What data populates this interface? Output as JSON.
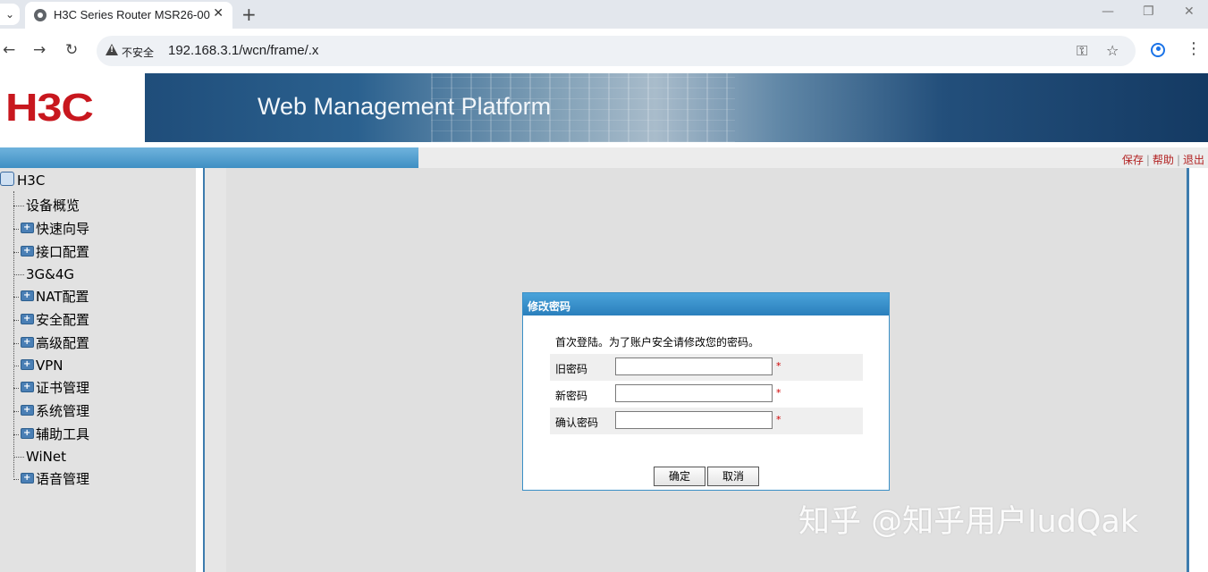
{
  "browser": {
    "tab_title": "H3C Series Router MSR26-00",
    "tab_menu_glyph": "⌄",
    "tab_close_glyph": "✕",
    "new_tab_glyph": "+",
    "window_controls": {
      "minimize": "—",
      "restore": "❐",
      "close": "✕"
    },
    "nav": {
      "back": "←",
      "forward": "→",
      "reload": "↻"
    },
    "security_label": "不安全",
    "url": "192.168.3.1/wcn/frame/.x",
    "icons": {
      "key": "⚿",
      "star": "☆",
      "menu": "⋮"
    }
  },
  "header": {
    "logo_text": "H3C",
    "title": "Web Management Platform",
    "links": {
      "save": "保存",
      "help": "帮助",
      "logout": "退出"
    },
    "accent_color": "#3d7cae",
    "brand_color": "#c8171e"
  },
  "sidebar": {
    "root": "H3C",
    "items": [
      {
        "label": "设备概览",
        "folder": false
      },
      {
        "label": "快速向导",
        "folder": true
      },
      {
        "label": "接口配置",
        "folder": true
      },
      {
        "label": "3G&4G",
        "folder": false
      },
      {
        "label": "NAT配置",
        "folder": true
      },
      {
        "label": "安全配置",
        "folder": true
      },
      {
        "label": "高级配置",
        "folder": true
      },
      {
        "label": "VPN",
        "folder": true
      },
      {
        "label": "证书管理",
        "folder": true
      },
      {
        "label": "系统管理",
        "folder": true
      },
      {
        "label": "辅助工具",
        "folder": true
      },
      {
        "label": "WiNet",
        "folder": false
      },
      {
        "label": "语音管理",
        "folder": true
      }
    ]
  },
  "dialog": {
    "title": "修改密码",
    "message": "首次登陆。为了账户安全请修改您的密码。",
    "fields": [
      {
        "label": "旧密码",
        "value": "",
        "required_mark": "*"
      },
      {
        "label": "新密码",
        "value": "",
        "required_mark": "*"
      },
      {
        "label": "确认密码",
        "value": "",
        "required_mark": "*"
      }
    ],
    "ok_label": "确定",
    "cancel_label": "取消"
  },
  "watermark": "知乎 @知乎用户IudQak"
}
